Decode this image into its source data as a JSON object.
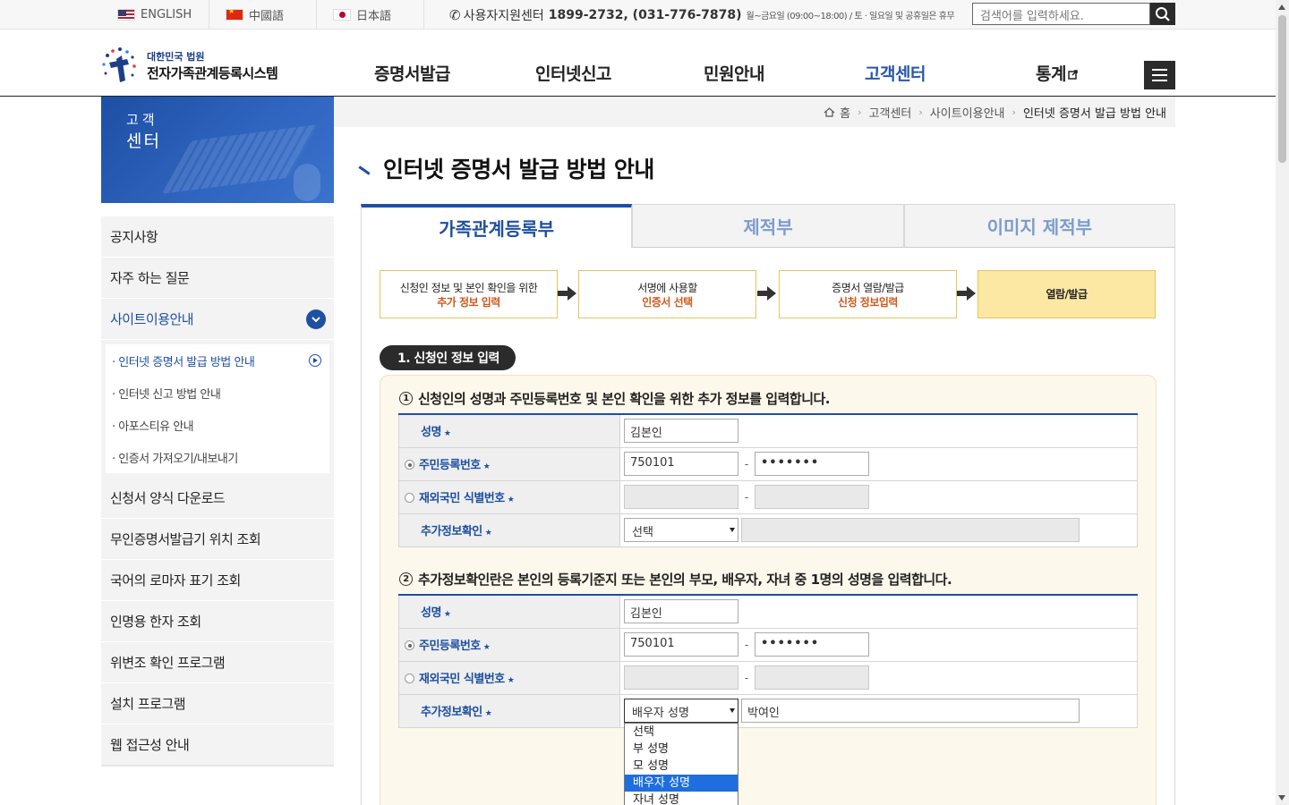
{
  "topbar": {
    "languages": [
      {
        "label": "ENGLISH",
        "flag": "us-flag"
      },
      {
        "label": "中國語",
        "flag": "cn-flag"
      },
      {
        "label": "日本語",
        "flag": "jp-flag"
      }
    ],
    "support_label": "사용자지원센터",
    "support_numbers": "1899-2732, (031-776-7878)",
    "support_hours": "월~금요일 (09:00~18:00) / 토 · 일요일 및 공휴일은 휴무",
    "search_placeholder": "검색어를 입력하세요."
  },
  "header": {
    "logo_sub": "대한민국 법원",
    "logo_main": "전자가족관계등록시스템",
    "nav": [
      "증명서발급",
      "인터넷신고",
      "민원안내",
      "고객센터",
      "통계"
    ],
    "active_nav": "고객센터"
  },
  "sidebar": {
    "banner_line1": "고객",
    "banner_line2": "센터",
    "items_top": [
      "공지사항",
      "자주 하는 질문",
      "사이트이용안내"
    ],
    "sub_items": [
      "· 인터넷 증명서 발급 방법 안내",
      "· 인터넷 신고 방법 안내",
      "· 아포스티유 안내",
      "· 인증서 가져오기/내보내기"
    ],
    "items_bottom": [
      "신청서 양식 다운로드",
      "무인증명서발급기 위치 조회",
      "국어의 로마자 표기 조회",
      "인명용 한자 조회",
      "위변조 확인 프로그램",
      "설치 프로그램",
      "웹 접근성 안내"
    ]
  },
  "breadcrumb": [
    "홈",
    "고객센터",
    "사이트이용안내",
    "인터넷 증명서 발급 방법 안내"
  ],
  "page_title": "인터넷 증명서 발급 방법 안내",
  "tabs": [
    "가족관계등록부",
    "제적부",
    "이미지 제적부"
  ],
  "steps": [
    {
      "line1": "신청인 정보 및 본인 확인을 위한",
      "line2": "추가 정보 입력"
    },
    {
      "line1": "서명에 사용할",
      "line2": "인증서 선택"
    },
    {
      "line1": "증명서 열람/발급",
      "line2": "신청 정보입력"
    },
    {
      "line1": "열람/발급",
      "line2": ""
    }
  ],
  "section_title": "1. 신청인 정보 입력",
  "instructions": [
    "신청인의 성명과 주민등록번호 및 본인 확인을 위한 추가 정보를 입력합니다.",
    "추가정보확인란은 본인의 등록기준지 또는 본인의 부모, 배우자, 자녀 중 1명의 성명을 입력합니다."
  ],
  "form_labels": {
    "name": "성명",
    "rrn": "주민등록번호",
    "foreign_id": "재외국민 식별번호",
    "extra": "추가정보확인",
    "star": "★"
  },
  "form1": {
    "name": "김본인",
    "rrn_front": "750101",
    "rrn_back": "•••••••",
    "extra_select": "선택",
    "extra_value": ""
  },
  "form2": {
    "name": "김본인",
    "rrn_front": "750101",
    "rrn_back": "•••••••",
    "extra_select": "배우자 성명",
    "extra_value": "박여인"
  },
  "dropdown_options": [
    "선택",
    "부 성명",
    "모 성명",
    "배우자 성명",
    "자녀 성명"
  ],
  "dropdown_selected_index": 3,
  "colors": {
    "brand": "#1e4fa0",
    "step_border": "#e8c55c",
    "step_active": "#fde8a3",
    "highlight": "#d0581b"
  }
}
